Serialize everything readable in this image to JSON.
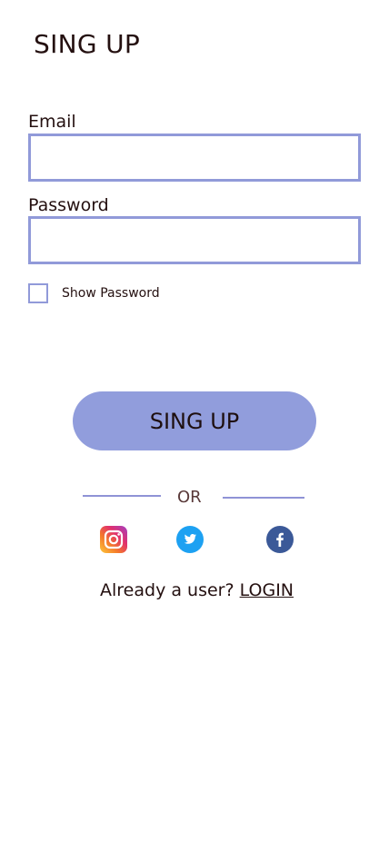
{
  "header": {
    "title": "SING UP"
  },
  "form": {
    "email_label": "Email",
    "email_value": "",
    "password_label": "Password",
    "password_value": "",
    "show_password_label": "Show Password",
    "show_password_checked": false,
    "submit_label": "SING UP"
  },
  "divider": {
    "text": "OR"
  },
  "social": {
    "icons": [
      "instagram-icon",
      "twitter-icon",
      "facebook-icon"
    ]
  },
  "footer": {
    "prompt": "Already a user?",
    "login_label": "LOGIN"
  },
  "colors": {
    "accent": "#919ddc",
    "border": "#919ad9",
    "instagram_orange": "#f58529",
    "twitter_blue": "#1da1f2",
    "facebook_blue": "#3b5998"
  }
}
